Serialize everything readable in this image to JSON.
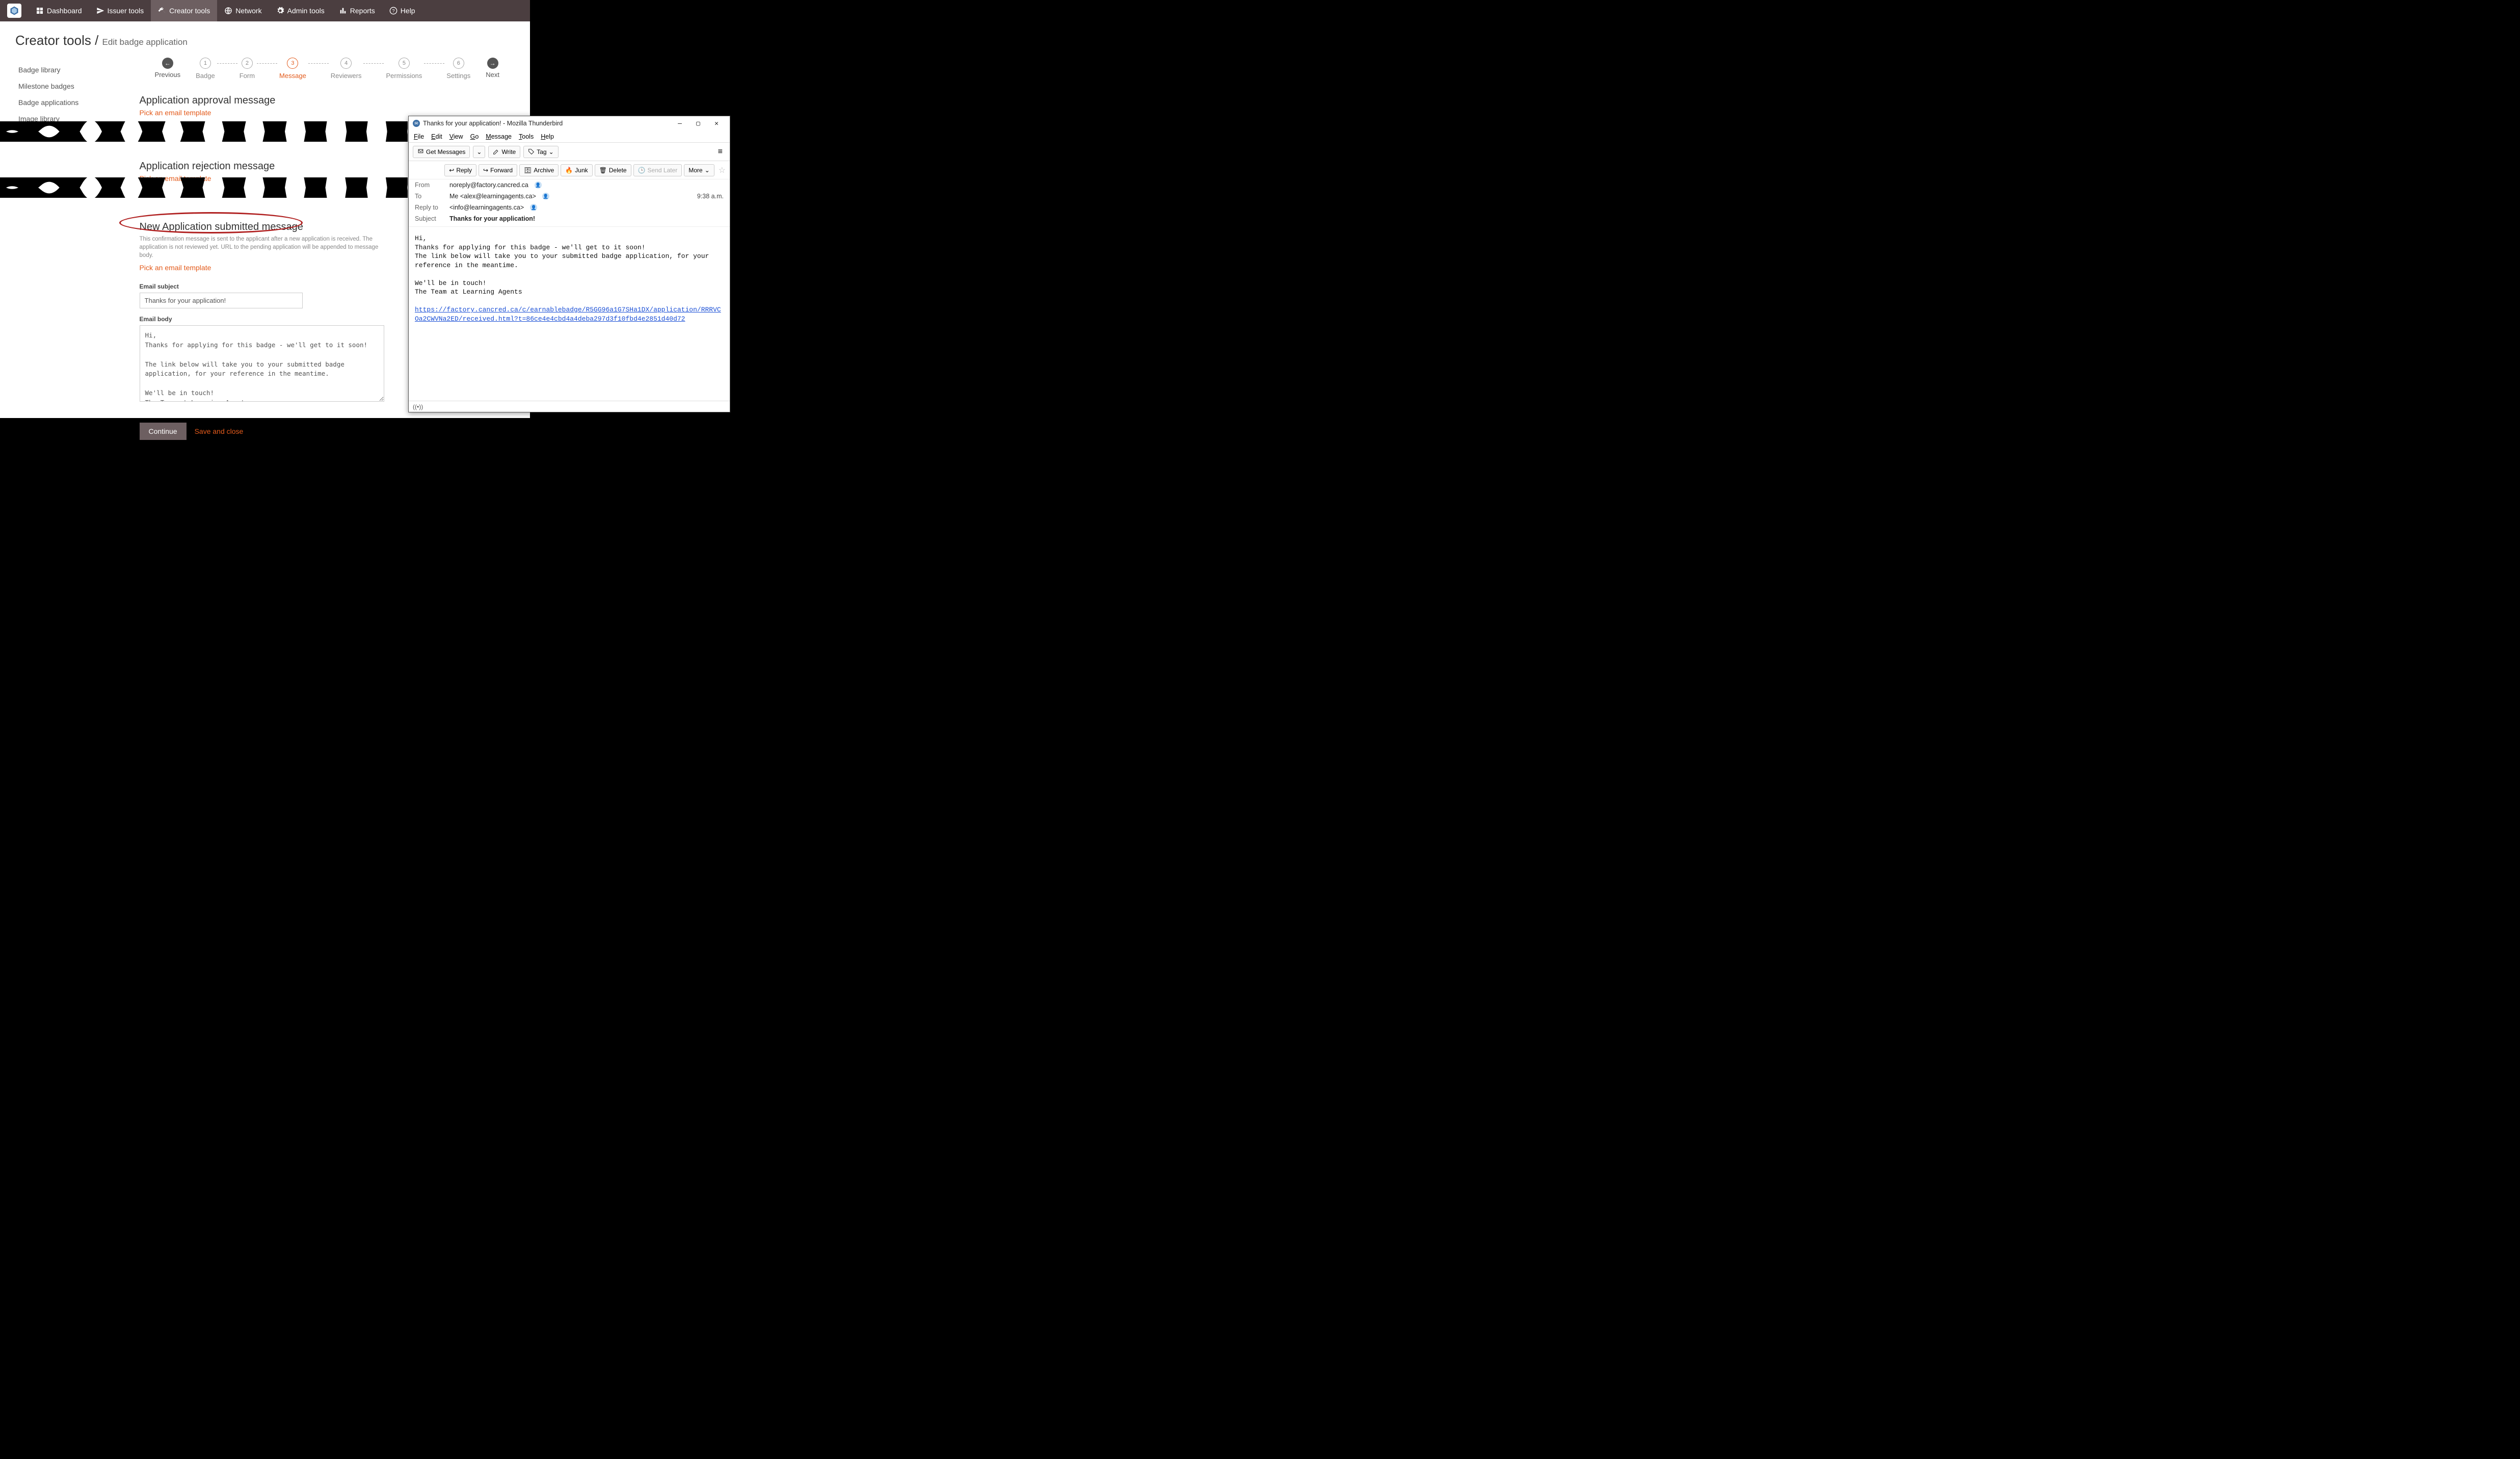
{
  "nav": {
    "items": [
      {
        "label": "Dashboard"
      },
      {
        "label": "Issuer tools"
      },
      {
        "label": "Creator tools"
      },
      {
        "label": "Network"
      },
      {
        "label": "Admin tools"
      },
      {
        "label": "Reports"
      },
      {
        "label": "Help"
      }
    ],
    "active_index": 2
  },
  "breadcrumb": {
    "main": "Creator tools /",
    "sub": "Edit badge application"
  },
  "sidebar": {
    "items": [
      {
        "label": "Badge library"
      },
      {
        "label": "Milestone badges"
      },
      {
        "label": "Badge applications"
      },
      {
        "label": "Image library"
      }
    ]
  },
  "stepper": {
    "prev_label": "Previous",
    "next_label": "Next",
    "steps": [
      {
        "num": "1",
        "label": "Badge"
      },
      {
        "num": "2",
        "label": "Form"
      },
      {
        "num": "3",
        "label": "Message"
      },
      {
        "num": "4",
        "label": "Reviewers"
      },
      {
        "num": "5",
        "label": "Permissions"
      },
      {
        "num": "6",
        "label": "Settings"
      }
    ],
    "active_index": 2
  },
  "sections": {
    "approval": {
      "title": "Application approval message",
      "pick": "Pick an email template"
    },
    "rejection": {
      "title": "Application rejection message",
      "pick": "Pick an email template"
    },
    "new_app": {
      "title": "New Application submitted message",
      "desc": "This confirmation message is sent to the applicant after a new application is received. The application is not reviewed yet. URL to the pending application will be appended to message body.",
      "pick": "Pick an email template",
      "subject_label": "Email subject",
      "subject_value": "Thanks for your application!",
      "body_label": "Email body",
      "body_value": "Hi,\nThanks for applying for this badge - we'll get to it soon!\n\nThe link below will take you to your submitted badge application, for your reference in the meantime.\n\nWe'll be in touch!\nThe Team at Learning Agents"
    }
  },
  "actions": {
    "continue": "Continue",
    "save_close": "Save and close"
  },
  "thunderbird": {
    "window_title": "Thanks for your application! - Mozilla Thunderbird",
    "menu": [
      "File",
      "Edit",
      "View",
      "Go",
      "Message",
      "Tools",
      "Help"
    ],
    "toolbar": {
      "get": "Get Messages",
      "write": "Write",
      "tag": "Tag"
    },
    "actions": {
      "reply": "Reply",
      "forward": "Forward",
      "archive": "Archive",
      "junk": "Junk",
      "delete": "Delete",
      "sendlater": "Send Later",
      "more": "More"
    },
    "headers": {
      "from_label": "From",
      "from": "noreply@factory.cancred.ca",
      "to_label": "To",
      "to": "Me <alex@learningagents.ca>",
      "reply_label": "Reply to",
      "reply": "<info@learningagents.ca>",
      "subject_label": "Subject",
      "subject": "Thanks for your application!",
      "time": "9:38 a.m."
    },
    "body_pre": "Hi,\nThanks for applying for this badge - we'll get to it soon!\nThe link below will take you to your submitted badge application, for your reference in the meantime.\n\nWe'll be in touch!\nThe Team at Learning Agents\n\n",
    "link": "https://factory.cancred.ca/c/earnablebadge/R5GG96a1G7SHa1DX/application/RRRVCOa2CWVNa2ED/received.html?t=86ce4e4cbd4a4deba297d3f10fbd4e2851d40d72",
    "status": "((•))"
  }
}
